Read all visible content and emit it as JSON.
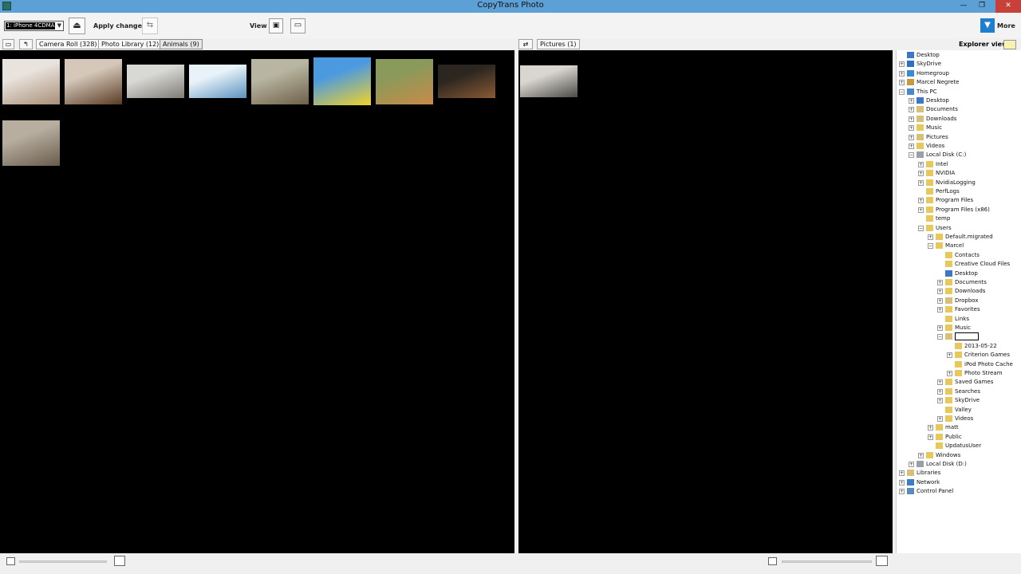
{
  "window": {
    "title": "CopyTrans Photo",
    "controls": [
      "—",
      "❐",
      "✕"
    ]
  },
  "toolbar": {
    "device_value": "1: iPhone 4CDMA",
    "apply_label": "Apply changes",
    "view_label": "View",
    "more_label": "More"
  },
  "left_tabs": [
    "Camera Roll (328)",
    "Photo Library (12)",
    "Animals (9)"
  ],
  "right_tab": "Pictures (1)",
  "explorer_label": "Explorer view",
  "left_photos": [
    {
      "name": "kitten-and-puppy",
      "colors": [
        "#e8e3dc",
        "#a98e78"
      ]
    },
    {
      "name": "bear",
      "colors": [
        "#d5c8ba",
        "#5a3b24"
      ]
    },
    {
      "name": "koala",
      "colors": [
        "#d8d8d4",
        "#7f7c76"
      ]
    },
    {
      "name": "seal-pup",
      "colors": [
        "#e9f2f8",
        "#5a93c0"
      ]
    },
    {
      "name": "sea-lions",
      "colors": [
        "#b8b6a2",
        "#6f6048"
      ]
    },
    {
      "name": "rubber-duck",
      "colors": [
        "#4b9ae0",
        "#f2d22a"
      ]
    },
    {
      "name": "fox-kits",
      "colors": [
        "#8a9a5a",
        "#c88a48"
      ]
    },
    {
      "name": "orangutan",
      "colors": [
        "#2b2620",
        "#8b5a33"
      ]
    },
    {
      "name": "coyote",
      "colors": [
        "#b7aea0",
        "#6a5c4c"
      ]
    }
  ],
  "right_photos": [
    {
      "name": "office-room",
      "colors": [
        "#d9d6cf",
        "#4a4a46"
      ]
    }
  ],
  "tree": [
    {
      "label": "Desktop",
      "level": 0,
      "exp": "",
      "icon": "desktop"
    },
    {
      "label": "SkyDrive",
      "level": 0,
      "exp": "+",
      "icon": "cloud"
    },
    {
      "label": "Homegroup",
      "level": 0,
      "exp": "+",
      "icon": "group"
    },
    {
      "label": "Marcel Negrete",
      "level": 0,
      "exp": "+",
      "icon": "user"
    },
    {
      "label": "This PC",
      "level": 0,
      "exp": "−",
      "icon": "pc"
    },
    {
      "label": "Desktop",
      "level": 1,
      "exp": "+",
      "icon": "desktop"
    },
    {
      "label": "Documents",
      "level": 1,
      "exp": "+",
      "icon": "docs"
    },
    {
      "label": "Downloads",
      "level": 1,
      "exp": "+",
      "icon": "docs"
    },
    {
      "label": "Music",
      "level": 1,
      "exp": "+",
      "icon": "folder"
    },
    {
      "label": "Pictures",
      "level": 1,
      "exp": "+",
      "icon": "docs"
    },
    {
      "label": "Videos",
      "level": 1,
      "exp": "+",
      "icon": "folder"
    },
    {
      "label": "Local Disk (C:)",
      "level": 1,
      "exp": "−",
      "icon": "drive"
    },
    {
      "label": "Intel",
      "level": 2,
      "exp": "+",
      "icon": "folder"
    },
    {
      "label": "NVIDIA",
      "level": 2,
      "exp": "+",
      "icon": "folder"
    },
    {
      "label": "NvidiaLogging",
      "level": 2,
      "exp": "+",
      "icon": "folder"
    },
    {
      "label": "PerfLogs",
      "level": 2,
      "exp": "",
      "icon": "folder"
    },
    {
      "label": "Program Files",
      "level": 2,
      "exp": "+",
      "icon": "folder"
    },
    {
      "label": "Program Files (x86)",
      "level": 2,
      "exp": "+",
      "icon": "folder"
    },
    {
      "label": "temp",
      "level": 2,
      "exp": "",
      "icon": "folder"
    },
    {
      "label": "Users",
      "level": 2,
      "exp": "−",
      "icon": "folder"
    },
    {
      "label": "Default.migrated",
      "level": 3,
      "exp": "+",
      "icon": "folder"
    },
    {
      "label": "Marcel",
      "level": 3,
      "exp": "−",
      "icon": "folder"
    },
    {
      "label": "Contacts",
      "level": 4,
      "exp": "",
      "icon": "folder"
    },
    {
      "label": "Creative Cloud Files",
      "level": 4,
      "exp": "",
      "icon": "folder"
    },
    {
      "label": "Desktop",
      "level": 4,
      "exp": "",
      "icon": "desktop"
    },
    {
      "label": "Documents",
      "level": 4,
      "exp": "+",
      "icon": "folder"
    },
    {
      "label": "Downloads",
      "level": 4,
      "exp": "+",
      "icon": "folder"
    },
    {
      "label": "Dropbox",
      "level": 4,
      "exp": "+",
      "icon": "docs"
    },
    {
      "label": "Favorites",
      "level": 4,
      "exp": "+",
      "icon": "folder"
    },
    {
      "label": "Links",
      "level": 4,
      "exp": "",
      "icon": "folder"
    },
    {
      "label": "Music",
      "level": 4,
      "exp": "+",
      "icon": "folder"
    },
    {
      "label": "",
      "level": 4,
      "exp": "−",
      "icon": "docs",
      "selected": true
    },
    {
      "label": "2013-05-22",
      "level": 5,
      "exp": "",
      "icon": "folder"
    },
    {
      "label": "Criterion Games",
      "level": 5,
      "exp": "+",
      "icon": "folder"
    },
    {
      "label": "iPod Photo Cache",
      "level": 5,
      "exp": "",
      "icon": "folder"
    },
    {
      "label": "Photo Stream",
      "level": 5,
      "exp": "+",
      "icon": "folder"
    },
    {
      "label": "Saved Games",
      "level": 4,
      "exp": "+",
      "icon": "folder"
    },
    {
      "label": "Searches",
      "level": 4,
      "exp": "+",
      "icon": "folder"
    },
    {
      "label": "SkyDrive",
      "level": 4,
      "exp": "+",
      "icon": "folder"
    },
    {
      "label": "Valley",
      "level": 4,
      "exp": "",
      "icon": "folder"
    },
    {
      "label": "Videos",
      "level": 4,
      "exp": "+",
      "icon": "folder"
    },
    {
      "label": "matt",
      "level": 3,
      "exp": "+",
      "icon": "folder"
    },
    {
      "label": "Public",
      "level": 3,
      "exp": "+",
      "icon": "folder"
    },
    {
      "label": "UpdatusUser",
      "level": 3,
      "exp": "",
      "icon": "folder"
    },
    {
      "label": "Windows",
      "level": 2,
      "exp": "+",
      "icon": "folder"
    },
    {
      "label": "Local Disk (D:)",
      "level": 1,
      "exp": "+",
      "icon": "drive"
    },
    {
      "label": "Libraries",
      "level": 0,
      "exp": "+",
      "icon": "docs"
    },
    {
      "label": "Network",
      "level": 0,
      "exp": "+",
      "icon": "net"
    },
    {
      "label": "Control Panel",
      "level": 0,
      "exp": "+",
      "icon": "panel"
    }
  ],
  "icon_colors": {
    "folder": "#e8c85a",
    "desktop": "#3d78c8",
    "docs": "#d8c078",
    "drive": "#9aa0a8",
    "cloud": "#2d6fc4",
    "group": "#3a8ad0",
    "user": "#c89a40",
    "pc": "#4a86cc",
    "net": "#3a7ec8",
    "panel": "#5a8ac0"
  }
}
